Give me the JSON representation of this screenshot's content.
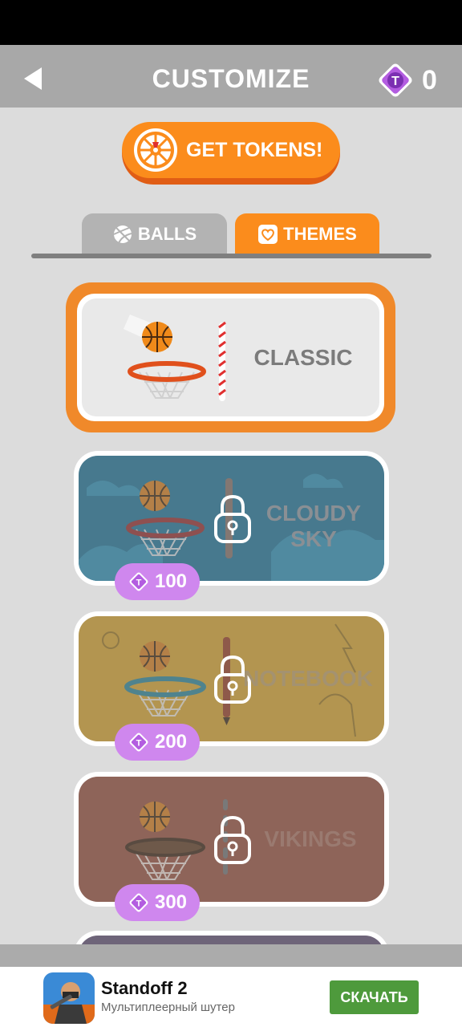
{
  "header": {
    "title": "CUSTOMIZE",
    "token_count": "0"
  },
  "get_tokens": {
    "label": "GET TOKENS!"
  },
  "tabs": [
    {
      "label": "BALLS",
      "selected": false
    },
    {
      "label": "THEMES",
      "selected": true
    }
  ],
  "themes": [
    {
      "name": "CLASSIC",
      "selected": true,
      "locked": false
    },
    {
      "name_line1": "CLOUDY",
      "name_line2": "SKY",
      "price": "100",
      "locked": true
    },
    {
      "name": "NOTEBOOK",
      "price": "200",
      "locked": true
    },
    {
      "name": "VIKINGS",
      "price": "300",
      "locked": true
    }
  ],
  "ad": {
    "title": "Standoff 2",
    "subtitle": "Мультиплеерный шутер",
    "button": "СКАЧАТЬ"
  },
  "colors": {
    "accent": "#fb8c1c",
    "token_purple": "#cf87ee",
    "header_gray": "#a8a8a8",
    "ad_green": "#4e9a3c"
  }
}
